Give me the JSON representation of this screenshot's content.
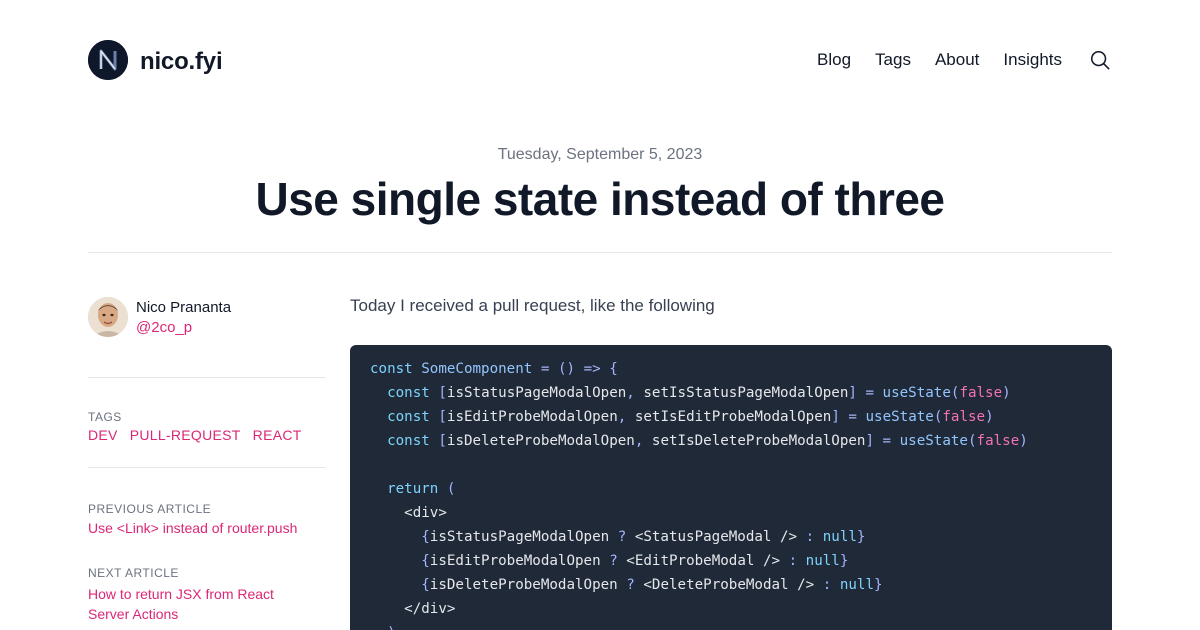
{
  "header": {
    "site_name": "nico.fyi",
    "nav": [
      "Blog",
      "Tags",
      "About",
      "Insights"
    ]
  },
  "post": {
    "date": "Tuesday, September 5, 2023",
    "title": "Use single state instead of three",
    "lead": "Today I received a pull request, like the following"
  },
  "author": {
    "name": "Nico Prananta",
    "handle": "@2co_p"
  },
  "sidebar": {
    "tags_label": "TAGS",
    "tags": [
      "DEV",
      "PULL-REQUEST",
      "REACT"
    ],
    "prev_label": "PREVIOUS ARTICLE",
    "prev_title": "Use <Link> instead of router.push",
    "next_label": "NEXT ARTICLE",
    "next_title_line1": "How to return JSX from React",
    "next_title_line2": "Server Actions"
  },
  "code": {
    "lines": [
      "const SomeComponent = () => {",
      "  const [isStatusPageModalOpen, setIsStatusPageModalOpen] = useState(false)",
      "  const [isEditProbeModalOpen, setIsEditProbeModalOpen] = useState(false)",
      "  const [isDeleteProbeModalOpen, setIsDeleteProbeModalOpen] = useState(false)",
      "",
      "  return (",
      "    <div>",
      "      {isStatusPageModalOpen ? <StatusPageModal /> : null}",
      "      {isEditProbeModalOpen ? <EditProbeModal /> : null}",
      "      {isDeleteProbeModalOpen ? <DeleteProbeModal /> : null}",
      "    </div>",
      "  )"
    ]
  },
  "colors": {
    "accent": "#db2777",
    "code_bg": "#1f2937",
    "logo_bg": "#0f172a"
  },
  "icons": [
    "logo-n-icon",
    "search-icon",
    "avatar"
  ]
}
